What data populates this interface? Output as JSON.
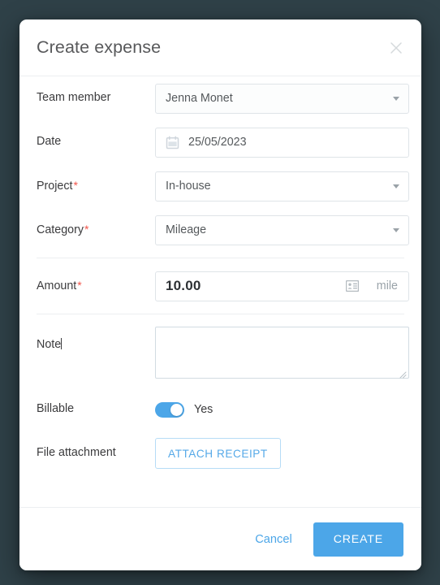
{
  "theme": {
    "backdrop": "#2f4148",
    "accent": "#4ca6e8",
    "required_marker": "#f2544a",
    "border": "#dfe4e8",
    "text": "#3b3b3d"
  },
  "dialog": {
    "title": "Create expense",
    "close_icon": "close-icon"
  },
  "fields": {
    "team_member": {
      "label": "Team member",
      "value": "Jenna Monet",
      "required": false,
      "control": "dropdown"
    },
    "date": {
      "label": "Date",
      "value": "25/05/2023",
      "required": false,
      "control": "datepicker",
      "icon": "calendar-icon"
    },
    "project": {
      "label": "Project",
      "value": "In-house",
      "required": true,
      "required_marker": "*",
      "control": "dropdown"
    },
    "category": {
      "label": "Category",
      "value": "Mileage",
      "required": true,
      "required_marker": "*",
      "control": "dropdown"
    },
    "amount": {
      "label": "Amount",
      "value": "10.00",
      "unit": "mile",
      "required": true,
      "required_marker": "*",
      "icon": "id-card-icon"
    },
    "note": {
      "label": "Note",
      "value": "",
      "placeholder": "",
      "required": false,
      "control": "textarea"
    },
    "billable": {
      "label": "Billable",
      "state_label": "Yes",
      "checked": true,
      "control": "toggle"
    },
    "file_attachment": {
      "label": "File attachment",
      "button_label": "ATTACH RECEIPT"
    }
  },
  "footer": {
    "cancel_label": "Cancel",
    "create_label": "CREATE"
  }
}
